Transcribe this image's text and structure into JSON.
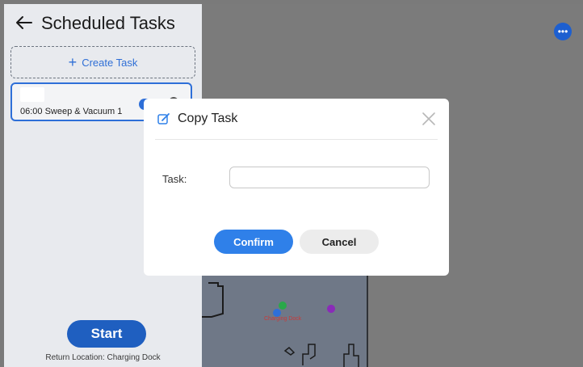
{
  "header": {
    "title": "Scheduled Tasks",
    "back_icon": "arrow-left-icon"
  },
  "create_task": {
    "label": "Create Task",
    "icon": "plus-icon"
  },
  "tasks": [
    {
      "label": "06:00 Sweep & Vacuum 1",
      "enabled": true
    }
  ],
  "footer": {
    "start_label": "Start",
    "return_location": "Return Location: Charging Dock"
  },
  "map": {
    "dock_label": "Charging Dock",
    "more_icon": "more-icon"
  },
  "modal": {
    "title": "Copy Task",
    "title_icon": "edit-icon",
    "close_icon": "close-icon",
    "field_label": "Task:",
    "field_value": "",
    "confirm_label": "Confirm",
    "cancel_label": "Cancel"
  },
  "colors": {
    "accent": "#2f80e9",
    "start_button": "#1f5fc0",
    "overlay": "#7a7a7a"
  }
}
